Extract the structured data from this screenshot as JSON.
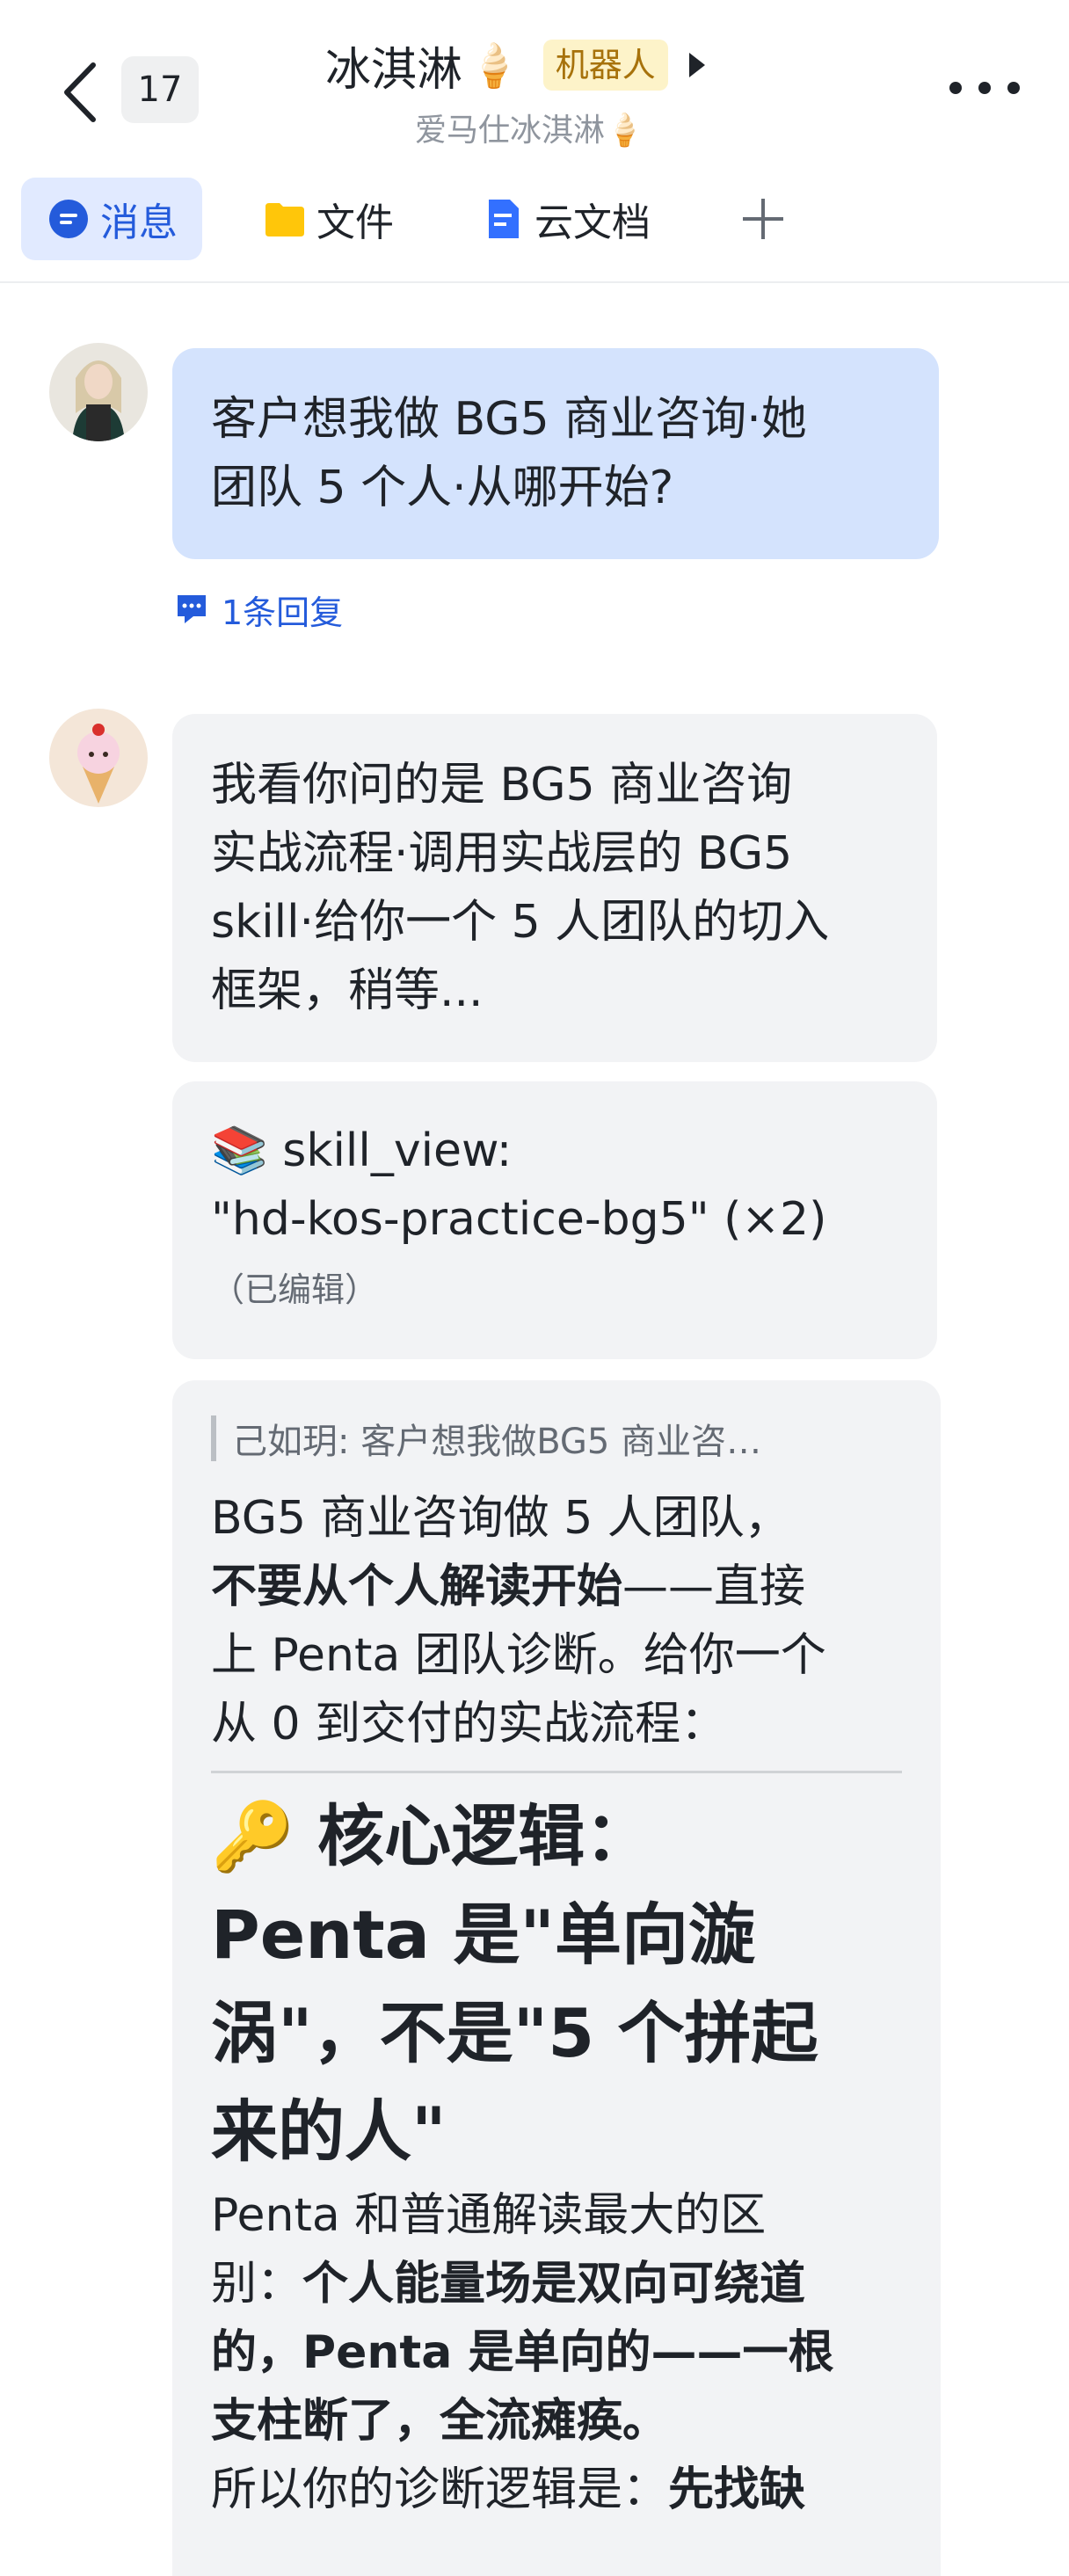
{
  "header": {
    "back_count": "17",
    "title": "冰淇淋",
    "title_emoji": "🍦",
    "bot_tag": "机器人",
    "subtitle": "爱马仕冰淇淋🍦"
  },
  "tabs": [
    {
      "label": "消息",
      "icon": "message-icon",
      "active": true
    },
    {
      "label": "文件",
      "icon": "folder-icon",
      "active": false
    },
    {
      "label": "云文档",
      "icon": "doc-icon",
      "active": false
    },
    {
      "label": "",
      "icon": "plus-icon",
      "active": false
    }
  ],
  "messages": {
    "user": {
      "text_line1": "客户想我做 BG5 商业咨询·她",
      "text_line2": "团队 5 个人·从哪开始?",
      "reply_count_label": "1条回复"
    },
    "bot1": {
      "line1": "我看你问的是 BG5 商业咨询",
      "line2": "实战流程·调用实战层的 BG5",
      "line3": "skill·给你一个 5 人团队的切入",
      "line4": "框架，稍等..."
    },
    "bot2": {
      "line1": "📚 skill_view:",
      "line2": "\"hd-kos-practice-bg5\" (×2)",
      "edited": "（已编辑）"
    },
    "bot3": {
      "quote": "己如玥: 客户想我做BG5 商业咨…",
      "p1_line1": "BG5 商业咨询做 5 人团队，",
      "p1_bold": "不要从个人解读开始",
      "p1_line2_rest": "——直接",
      "p1_line3": "上 Penta 团队诊断。给你一个",
      "p1_line4": "从 0 到交付的实战流程：",
      "heading_line1": "🔑 核心逻辑：",
      "heading_line2": "Penta 是\"单向漩",
      "heading_line3": "涡\"，不是\"5 个拼起",
      "heading_line4": "来的人\"",
      "p2_line1": "Penta 和普通解读最大的区",
      "p2_line2_pre": "别：",
      "p2_line2_bold": "个人能量场是双向可绕道",
      "p2_line3_bold": "的，Penta 是单向的——一根",
      "p2_line4_bold": "支柱断了，全流瘫痪。",
      "p3_pre": "所以你的诊断逻辑是：",
      "p3_bold": "先找缺"
    }
  },
  "colors": {
    "accent": "#245bdb",
    "user_bubble": "#d4e3fd",
    "bot_bubble": "#f2f3f5",
    "bot_tag_bg": "#fdf3c9",
    "bot_tag_text": "#a7720b"
  }
}
